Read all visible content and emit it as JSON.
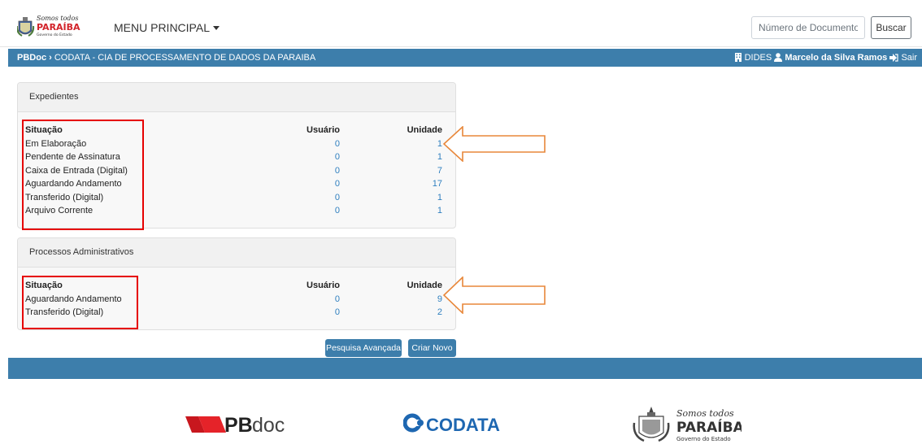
{
  "header": {
    "menu_label": "MENU PRINCIPAL",
    "search_placeholder": "Número de Documento",
    "search_button": "Buscar",
    "logo_script": "Somos todos",
    "logo_name": "PARAÍBA",
    "logo_sub": "Governo do Estado"
  },
  "breadcrumb": {
    "app": "PBDoc",
    "separator": "›",
    "org": "CODATA - CIA DE PROCESSAMENTO DE DADOS DA PARAIBA"
  },
  "user": {
    "unit": "DIDES",
    "name": "Marcelo da Silva Ramos",
    "logout": "Sair"
  },
  "expedientes": {
    "title": "Expedientes",
    "col_situacao": "Situação",
    "col_usuario": "Usuário",
    "col_unidade": "Unidade",
    "rows": [
      {
        "label": "Em Elaboração",
        "usuario": "0",
        "unidade": "1"
      },
      {
        "label": "Pendente de Assinatura",
        "usuario": "0",
        "unidade": "1"
      },
      {
        "label": "Caixa de Entrada (Digital)",
        "usuario": "0",
        "unidade": "7"
      },
      {
        "label": "Aguardando Andamento",
        "usuario": "0",
        "unidade": "17"
      },
      {
        "label": "Transferido (Digital)",
        "usuario": "0",
        "unidade": "1"
      },
      {
        "label": "Arquivo Corrente",
        "usuario": "0",
        "unidade": "1"
      }
    ]
  },
  "processos": {
    "title": "Processos Administrativos",
    "col_situacao": "Situação",
    "col_usuario": "Usuário",
    "col_unidade": "Unidade",
    "rows": [
      {
        "label": "Aguardando Andamento",
        "usuario": "0",
        "unidade": "9"
      },
      {
        "label": "Transferido (Digital)",
        "usuario": "0",
        "unidade": "2"
      }
    ]
  },
  "actions": {
    "advanced_search": "Pesquisa Avançada",
    "create_new": "Criar Novo"
  },
  "footer": {
    "pbdoc_bold": "PB",
    "pbdoc_light": "doc",
    "codata": "CODATA",
    "pb_script": "Somos todos",
    "pb_name": "PARAÍBA",
    "pb_sub": "Governo do Estado"
  },
  "colors": {
    "brand_blue": "#3d7eab",
    "link_blue": "#2f7fbf",
    "annotation_red": "#e60000",
    "annotation_orange": "#e8873a"
  }
}
